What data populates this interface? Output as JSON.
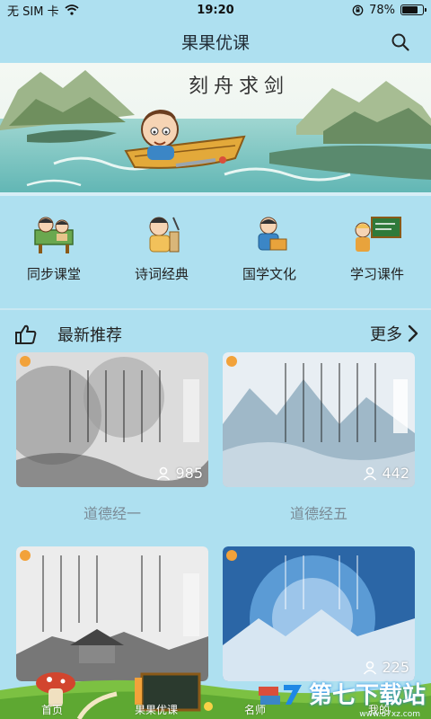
{
  "status": {
    "carrier": "无 SIM 卡",
    "time": "19:20",
    "battery": "78%",
    "battery_level": 0.78
  },
  "nav": {
    "title": "果果优课"
  },
  "banner": {
    "title": "刻舟求剑"
  },
  "categories": [
    {
      "label": "同步课堂",
      "icon": "classroom-icon"
    },
    {
      "label": "诗词经典",
      "icon": "poetry-icon"
    },
    {
      "label": "国学文化",
      "icon": "chinese-culture-icon"
    },
    {
      "label": "学习课件",
      "icon": "courseware-icon"
    }
  ],
  "section": {
    "title": "最新推荐",
    "more": "更多"
  },
  "cards": [
    {
      "title": "道德经一",
      "count": "985"
    },
    {
      "title": "道德经五",
      "count": "442"
    },
    {
      "title": "",
      "count": ""
    },
    {
      "title": "",
      "count": "225"
    }
  ],
  "tabs": [
    {
      "label": "首页"
    },
    {
      "label": "果果优课"
    },
    {
      "label": "名师"
    },
    {
      "label": "我的"
    }
  ],
  "watermark": {
    "text": "第七下载站",
    "url": "www.d7xz.com"
  },
  "colors": {
    "background": "#aee0f0",
    "accent": "#f2a23a",
    "text": "#222222",
    "muted": "#7a8a95"
  }
}
